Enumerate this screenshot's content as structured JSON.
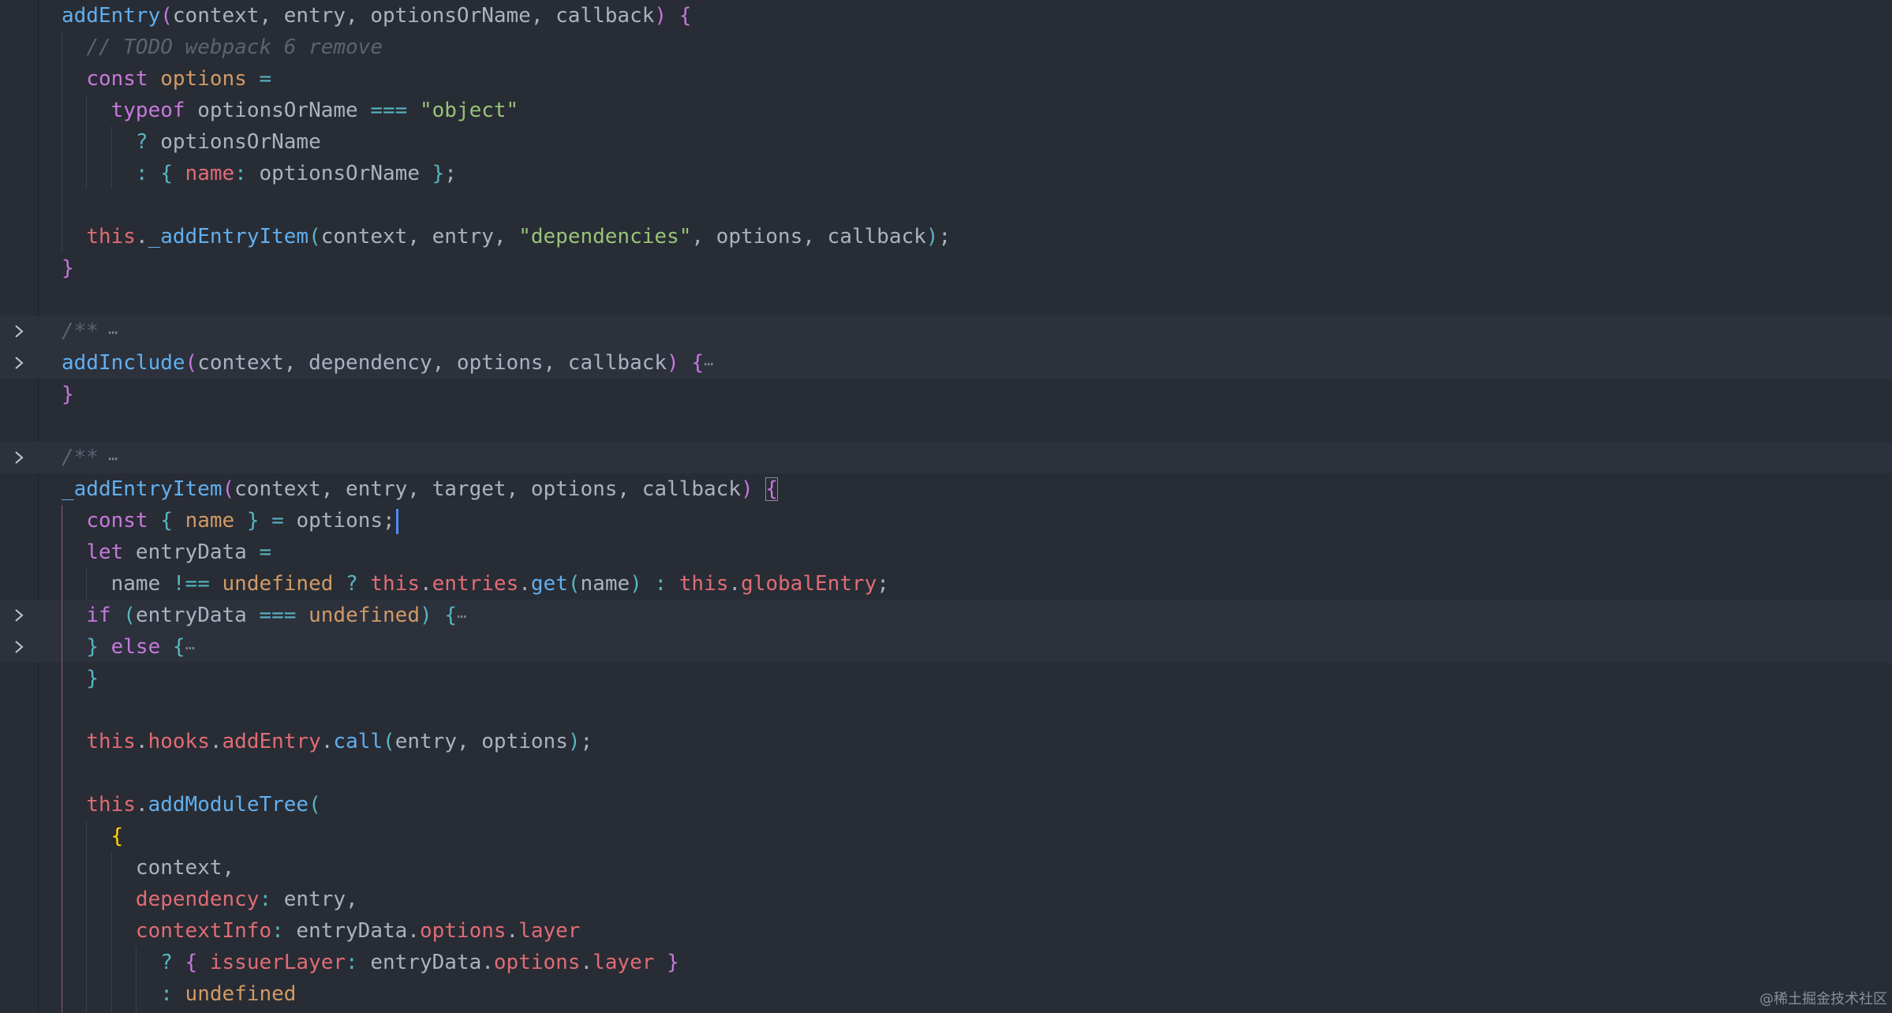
{
  "editor": {
    "theme_colors": {
      "background": "#282c34",
      "keyword": "#c678dd",
      "function": "#61afef",
      "string": "#98c379",
      "comment": "#5c6370",
      "variable": "#e06c75",
      "operator": "#56b6c2",
      "constant": "#d19a66",
      "cursor": "#528bff"
    },
    "lines": [
      {
        "fold": false,
        "highlight": false,
        "tokens": [
          [
            "f",
            "addEntry"
          ],
          [
            "pk",
            "("
          ],
          [
            "t",
            "context, entry, optionsOrName, callback"
          ],
          [
            "pk",
            ")"
          ],
          [
            "t",
            " "
          ],
          [
            "pk",
            "{"
          ]
        ]
      },
      {
        "fold": false,
        "highlight": false,
        "tokens": [
          [
            "t",
            "  "
          ],
          [
            "c",
            "// TODO webpack 6 remove"
          ]
        ]
      },
      {
        "fold": false,
        "highlight": false,
        "tokens": [
          [
            "t",
            "  "
          ],
          [
            "k",
            "const"
          ],
          [
            "t",
            " "
          ],
          [
            "n",
            "options"
          ],
          [
            "t",
            " "
          ],
          [
            "o",
            "="
          ]
        ]
      },
      {
        "fold": false,
        "highlight": false,
        "tokens": [
          [
            "t",
            "    "
          ],
          [
            "k",
            "typeof"
          ],
          [
            "t",
            " optionsOrName "
          ],
          [
            "o",
            "==="
          ],
          [
            "t",
            " "
          ],
          [
            "s",
            "\"object\""
          ]
        ]
      },
      {
        "fold": false,
        "highlight": false,
        "tokens": [
          [
            "t",
            "      "
          ],
          [
            "o",
            "?"
          ],
          [
            "t",
            " optionsOrName"
          ]
        ]
      },
      {
        "fold": false,
        "highlight": false,
        "tokens": [
          [
            "t",
            "      "
          ],
          [
            "o",
            ":"
          ],
          [
            "t",
            " "
          ],
          [
            "pb",
            "{"
          ],
          [
            "t",
            " "
          ],
          [
            "v",
            "name"
          ],
          [
            "o",
            ":"
          ],
          [
            "t",
            " optionsOrName "
          ],
          [
            "pb",
            "}"
          ],
          [
            "t",
            ";"
          ]
        ]
      },
      {
        "fold": false,
        "highlight": false,
        "tokens": []
      },
      {
        "fold": false,
        "highlight": false,
        "tokens": [
          [
            "t",
            "  "
          ],
          [
            "v",
            "this"
          ],
          [
            "t",
            "."
          ],
          [
            "f",
            "_addEntryItem"
          ],
          [
            "pb",
            "("
          ],
          [
            "t",
            "context, entry, "
          ],
          [
            "s",
            "\"dependencies\""
          ],
          [
            "t",
            ", options, callback"
          ],
          [
            "pb",
            ")"
          ],
          [
            "t",
            ";"
          ]
        ]
      },
      {
        "fold": false,
        "highlight": false,
        "tokens": [
          [
            "pk",
            "}"
          ]
        ]
      },
      {
        "fold": false,
        "highlight": false,
        "tokens": []
      },
      {
        "fold": true,
        "highlight": true,
        "tokens": [
          [
            "c",
            "/**"
          ],
          [
            "fe",
            " ⋯"
          ]
        ]
      },
      {
        "fold": true,
        "highlight": true,
        "tokens": [
          [
            "f",
            "addInclude"
          ],
          [
            "pk",
            "("
          ],
          [
            "t",
            "context, dependency, options, callback"
          ],
          [
            "pk",
            ")"
          ],
          [
            "t",
            " "
          ],
          [
            "pk",
            "{"
          ],
          [
            "fe",
            "⋯"
          ]
        ]
      },
      {
        "fold": false,
        "highlight": false,
        "tokens": [
          [
            "pk",
            "}"
          ]
        ]
      },
      {
        "fold": false,
        "highlight": false,
        "tokens": []
      },
      {
        "fold": true,
        "highlight": true,
        "tokens": [
          [
            "c",
            "/**"
          ],
          [
            "fe",
            " ⋯"
          ]
        ]
      },
      {
        "fold": false,
        "highlight": false,
        "tokens": [
          [
            "f",
            "_addEntryItem"
          ],
          [
            "pk",
            "("
          ],
          [
            "t",
            "context, entry, target, options, callback"
          ],
          [
            "pk",
            ")"
          ],
          [
            "t",
            " "
          ],
          [
            "box",
            "{"
          ]
        ]
      },
      {
        "fold": false,
        "highlight": false,
        "tokens": [
          [
            "t",
            "  "
          ],
          [
            "k",
            "const"
          ],
          [
            "t",
            " "
          ],
          [
            "pb",
            "{"
          ],
          [
            "t",
            " "
          ],
          [
            "n",
            "name"
          ],
          [
            "t",
            " "
          ],
          [
            "pb",
            "}"
          ],
          [
            "t",
            " "
          ],
          [
            "o",
            "="
          ],
          [
            "t",
            " options;"
          ],
          [
            "cursor",
            ""
          ]
        ]
      },
      {
        "fold": false,
        "highlight": false,
        "tokens": [
          [
            "t",
            "  "
          ],
          [
            "k",
            "let"
          ],
          [
            "t",
            " entryData "
          ],
          [
            "o",
            "="
          ]
        ]
      },
      {
        "fold": false,
        "highlight": false,
        "tokens": [
          [
            "t",
            "    name "
          ],
          [
            "o",
            "!=="
          ],
          [
            "t",
            " "
          ],
          [
            "n",
            "undefined"
          ],
          [
            "t",
            " "
          ],
          [
            "o",
            "?"
          ],
          [
            "t",
            " "
          ],
          [
            "v",
            "this"
          ],
          [
            "t",
            "."
          ],
          [
            "v",
            "entries"
          ],
          [
            "t",
            "."
          ],
          [
            "f",
            "get"
          ],
          [
            "pb",
            "("
          ],
          [
            "t",
            "name"
          ],
          [
            "pb",
            ")"
          ],
          [
            "t",
            " "
          ],
          [
            "o",
            ":"
          ],
          [
            "t",
            " "
          ],
          [
            "v",
            "this"
          ],
          [
            "t",
            "."
          ],
          [
            "v",
            "globalEntry"
          ],
          [
            "t",
            ";"
          ]
        ]
      },
      {
        "fold": true,
        "highlight": true,
        "tokens": [
          [
            "t",
            "  "
          ],
          [
            "k",
            "if"
          ],
          [
            "t",
            " "
          ],
          [
            "pb",
            "("
          ],
          [
            "t",
            "entryData "
          ],
          [
            "o",
            "==="
          ],
          [
            "t",
            " "
          ],
          [
            "n",
            "undefined"
          ],
          [
            "pb",
            ")"
          ],
          [
            "t",
            " "
          ],
          [
            "pb",
            "{"
          ],
          [
            "fe",
            "⋯"
          ]
        ]
      },
      {
        "fold": true,
        "highlight": true,
        "tokens": [
          [
            "t",
            "  "
          ],
          [
            "pb",
            "}"
          ],
          [
            "t",
            " "
          ],
          [
            "k",
            "else"
          ],
          [
            "t",
            " "
          ],
          [
            "pb",
            "{"
          ],
          [
            "fe",
            "⋯"
          ]
        ]
      },
      {
        "fold": false,
        "highlight": false,
        "tokens": [
          [
            "t",
            "  "
          ],
          [
            "pb",
            "}"
          ]
        ]
      },
      {
        "fold": false,
        "highlight": false,
        "tokens": []
      },
      {
        "fold": false,
        "highlight": false,
        "tokens": [
          [
            "t",
            "  "
          ],
          [
            "v",
            "this"
          ],
          [
            "t",
            "."
          ],
          [
            "v",
            "hooks"
          ],
          [
            "t",
            "."
          ],
          [
            "v",
            "addEntry"
          ],
          [
            "t",
            "."
          ],
          [
            "f",
            "call"
          ],
          [
            "pb",
            "("
          ],
          [
            "t",
            "entry, options"
          ],
          [
            "pb",
            ")"
          ],
          [
            "t",
            ";"
          ]
        ]
      },
      {
        "fold": false,
        "highlight": false,
        "tokens": []
      },
      {
        "fold": false,
        "highlight": false,
        "tokens": [
          [
            "t",
            "  "
          ],
          [
            "v",
            "this"
          ],
          [
            "t",
            "."
          ],
          [
            "f",
            "addModuleTree"
          ],
          [
            "pb",
            "("
          ]
        ]
      },
      {
        "fold": false,
        "highlight": false,
        "tokens": [
          [
            "t",
            "    "
          ],
          [
            "py",
            "{"
          ]
        ]
      },
      {
        "fold": false,
        "highlight": false,
        "tokens": [
          [
            "t",
            "      context,"
          ]
        ]
      },
      {
        "fold": false,
        "highlight": false,
        "tokens": [
          [
            "t",
            "      "
          ],
          [
            "v",
            "dependency"
          ],
          [
            "o",
            ":"
          ],
          [
            "t",
            " entry,"
          ]
        ]
      },
      {
        "fold": false,
        "highlight": false,
        "tokens": [
          [
            "t",
            "      "
          ],
          [
            "v",
            "contextInfo"
          ],
          [
            "o",
            ":"
          ],
          [
            "t",
            " entryData."
          ],
          [
            "v",
            "options"
          ],
          [
            "t",
            "."
          ],
          [
            "v",
            "layer"
          ]
        ]
      },
      {
        "fold": false,
        "highlight": false,
        "tokens": [
          [
            "t",
            "        "
          ],
          [
            "o",
            "?"
          ],
          [
            "t",
            " "
          ],
          [
            "pk",
            "{"
          ],
          [
            "t",
            " "
          ],
          [
            "v",
            "issuerLayer"
          ],
          [
            "o",
            ":"
          ],
          [
            "t",
            " entryData."
          ],
          [
            "v",
            "options"
          ],
          [
            "t",
            "."
          ],
          [
            "v",
            "layer"
          ],
          [
            "t",
            " "
          ],
          [
            "pk",
            "}"
          ]
        ]
      },
      {
        "fold": false,
        "highlight": false,
        "tokens": [
          [
            "t",
            "        "
          ],
          [
            "o",
            ":"
          ],
          [
            "t",
            " "
          ],
          [
            "n",
            "undefined"
          ]
        ]
      }
    ]
  },
  "watermark": {
    "text": "@稀土掘金技术社区"
  }
}
